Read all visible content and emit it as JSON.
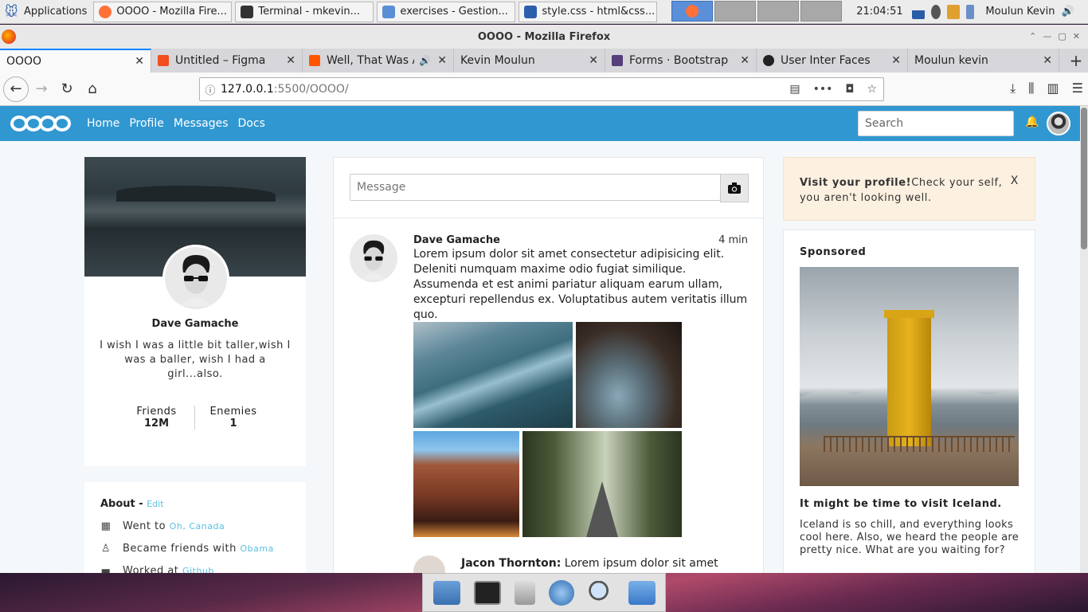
{
  "panel": {
    "applications_label": "Applications",
    "tasks": [
      {
        "label": "OOOO - Mozilla Fire...",
        "color": "#ff7139"
      },
      {
        "label": "Terminal - mkevin...",
        "color": "#333333"
      },
      {
        "label": "exercises - Gestion...",
        "color": "#5a8fd6"
      },
      {
        "label": "style.css - html&css...",
        "color": "#2b5fae"
      }
    ],
    "clock": "21:04:51",
    "user": "Moulun Kevin"
  },
  "window": {
    "title": "OOOO - Mozilla Firefox"
  },
  "tabs": [
    {
      "label": "OOOO",
      "active": true,
      "fav_color": "transparent"
    },
    {
      "label": "Untitled – Figma",
      "active": false,
      "fav_color": "#f24e1e"
    },
    {
      "label": "Well, That Was Aw",
      "active": false,
      "fav_color": "#ff5500"
    },
    {
      "label": "Kevin Moulun",
      "active": false,
      "fav_color": "transparent"
    },
    {
      "label": "Forms · Bootstrap",
      "active": false,
      "fav_color": "#563d7c"
    },
    {
      "label": "User Inter Faces",
      "active": false,
      "fav_color": "#222222"
    },
    {
      "label": "Moulun kevin",
      "active": false,
      "fav_color": "transparent"
    }
  ],
  "url": {
    "host": "127.0.0.1",
    "path": ":5500/OOOO/"
  },
  "site": {
    "brand_color": "#3097d1",
    "nav_links": [
      "Home",
      "Profile",
      "Messages",
      "Docs"
    ],
    "search_placeholder": "Search"
  },
  "profile": {
    "name": "Dave Gamache",
    "bio": "I wish I was a little bit taller,wish I was a baller, wish I had a girl...also.",
    "stats": [
      {
        "label": "Friends",
        "value": "12M"
      },
      {
        "label": "Enemies",
        "value": "1"
      }
    ]
  },
  "about": {
    "title": "About - ",
    "edit": "Edit",
    "items": [
      {
        "icon": "calendar-icon",
        "text": "Went to ",
        "link": "Oh, Canada"
      },
      {
        "icon": "user-icon",
        "text": "Became friends with ",
        "link": "Obama"
      },
      {
        "icon": "briefcase-icon",
        "text": "Worked at ",
        "link": "Github"
      }
    ]
  },
  "feed": {
    "message_placeholder": "Message",
    "post": {
      "author": "Dave Gamache",
      "time": "4 min",
      "text": "Lorem ipsum dolor sit amet consectetur adipisicing elit. Deleniti numquam maxime odio fugiat similique. Assumenda et est animi pariatur aliquam earum ullam, excepturi repellendus ex. Voluptatibus autem veritatis illum quo."
    },
    "next_post": {
      "author": "Jacon Thornton:",
      "text": " Lorem ipsum dolor sit amet"
    }
  },
  "alert": {
    "strong": "Visit your profile!",
    "text": "Check your self, you aren't looking well.",
    "close": "X"
  },
  "sponsored": {
    "heading": "Sponsored",
    "title": "It might be time to visit Iceland.",
    "text": "Iceland is so chill, and everything looks cool here. Also, we heard the people are pretty nice. What are you waiting for?"
  }
}
